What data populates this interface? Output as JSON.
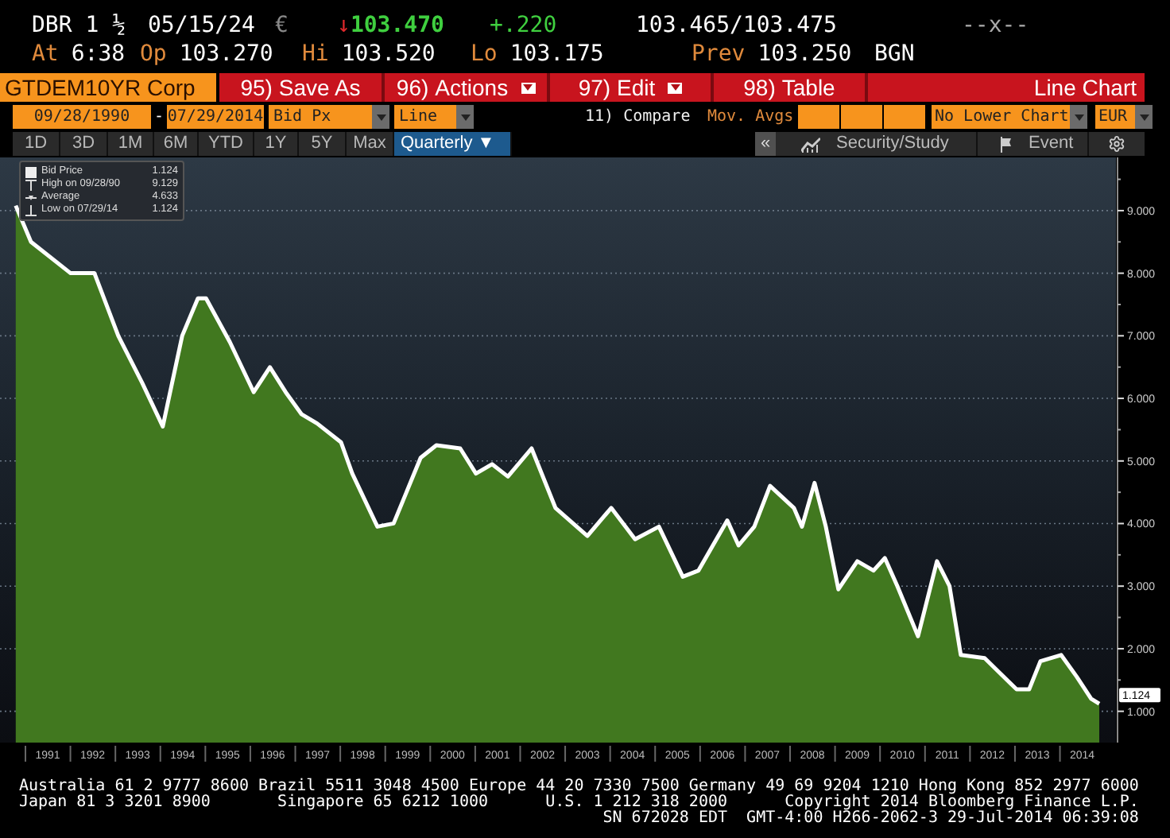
{
  "quote": {
    "security": "DBR 1 ½",
    "maturity": "05/15/24",
    "currency": "€",
    "arrow": "↓",
    "last": "103.470",
    "change": "+.220",
    "bid_ask": "103.465/103.475",
    "status": "--x--"
  },
  "stats": [
    {
      "label": "At",
      "value": "6:38"
    },
    {
      "label": "Op",
      "value": "103.270"
    },
    {
      "label": "Hi",
      "value": "103.520"
    },
    {
      "label": "Lo",
      "value": "103.175"
    },
    {
      "label": "Prev",
      "value": "103.250"
    }
  ],
  "source": "BGN",
  "ticker_field": "GTDEM10YR Corp",
  "menu_buttons": [
    {
      "number": "95)",
      "label": "Save As",
      "dropdown": false
    },
    {
      "number": "96)",
      "label": "Actions",
      "dropdown": true
    },
    {
      "number": "97)",
      "label": "Edit",
      "dropdown": true
    },
    {
      "number": "98)",
      "label": "Table",
      "dropdown": false
    }
  ],
  "view_title": "Line Chart",
  "settings": {
    "start_date": "09/28/1990",
    "separator": "-",
    "end_date": "07/29/2014",
    "field": "Bid Px",
    "chart_type": "Line",
    "compare": "11) Compare",
    "mov_avgs": "Mov. Avgs",
    "lower_chart": "No Lower Chart",
    "currency": "EUR"
  },
  "periods": [
    {
      "label": "1D",
      "selected": false
    },
    {
      "label": "3D",
      "selected": false
    },
    {
      "label": "1M",
      "selected": false
    },
    {
      "label": "6M",
      "selected": false
    },
    {
      "label": "YTD",
      "selected": false
    },
    {
      "label": "1Y",
      "selected": false
    },
    {
      "label": "5Y",
      "selected": false
    },
    {
      "label": "Max",
      "selected": false
    },
    {
      "label": "Quarterly ▼",
      "selected": true
    }
  ],
  "toolbar": {
    "collapse": "«",
    "security_study": "Security/Study",
    "event": "Event"
  },
  "legend": [
    {
      "kind": "price",
      "value": "1.124"
    },
    {
      "kind": "high",
      "label": "High on 09/28/90",
      "value": "9.129"
    },
    {
      "kind": "average",
      "label": "Average",
      "value": "4.633"
    },
    {
      "kind": "low",
      "label": "Low on 07/29/14",
      "value": "1.124"
    }
  ],
  "chart": {
    "last_label": "1.124",
    "chart_data": {
      "type": "area",
      "grid": true,
      "xlim": [
        1989.94,
        2014.75
      ],
      "ylim": [
        0.5,
        9.85
      ],
      "x": [
        1990.29,
        1990.63,
        1991.51,
        1992.04,
        1992.57,
        1993.1,
        1993.56,
        1993.99,
        1994.34,
        1994.52,
        1995.05,
        1995.58,
        1995.94,
        1996.29,
        1996.64,
        1996.99,
        1997.52,
        1997.77,
        1998.33,
        1998.69,
        1999.29,
        1999.64,
        2000.17,
        2000.52,
        2000.88,
        2001.23,
        2001.76,
        2002.29,
        2003.0,
        2003.53,
        2004.06,
        2004.59,
        2005.12,
        2005.47,
        2006.11,
        2006.36,
        2006.71,
        2007.06,
        2007.59,
        2007.77,
        2008.05,
        2008.3,
        2008.58,
        2009.0,
        2009.36,
        2009.61,
        2009.89,
        2010.35,
        2010.77,
        2011.05,
        2011.3,
        2011.83,
        2012.54,
        2012.82,
        2013.07,
        2013.53,
        2013.88,
        2014.2,
        2014.38
      ],
      "series": [
        {
          "name": "Bid Price",
          "color": "#ffffff",
          "values": [
            9.08,
            8.5,
            8.0,
            8.0,
            7.0,
            6.25,
            5.55,
            7.0,
            7.6,
            7.6,
            6.9,
            6.1,
            6.5,
            6.1,
            5.75,
            5.6,
            5.3,
            4.8,
            3.95,
            4.0,
            5.05,
            5.25,
            5.2,
            4.8,
            4.95,
            4.75,
            5.2,
            4.25,
            3.8,
            4.25,
            3.75,
            3.95,
            3.15,
            3.25,
            4.05,
            3.65,
            3.95,
            4.6,
            4.25,
            3.95,
            4.65,
            3.95,
            2.95,
            3.4,
            3.25,
            3.45,
            3.0,
            2.2,
            3.4,
            3.0,
            1.9,
            1.85,
            1.35,
            1.35,
            1.8,
            1.9,
            1.55,
            1.2,
            1.12
          ]
        }
      ],
      "xticks": [
        1991,
        1992,
        1993,
        1994,
        1995,
        1996,
        1997,
        1998,
        1999,
        2000,
        2001,
        2002,
        2003,
        2004,
        2005,
        2006,
        2007,
        2008,
        2009,
        2010,
        2011,
        2012,
        2013,
        2014
      ],
      "yticks": [
        {
          "value": 1,
          "label": "1.000"
        },
        {
          "value": 2,
          "label": "2.000"
        },
        {
          "value": 3,
          "label": "3.000"
        },
        {
          "value": 4,
          "label": "4.000"
        },
        {
          "value": 5,
          "label": "5.000"
        },
        {
          "value": 6,
          "label": "6.000"
        },
        {
          "value": 7,
          "label": "7.000"
        },
        {
          "value": 8,
          "label": "8.000"
        },
        {
          "value": 9,
          "label": "9.000"
        }
      ]
    }
  },
  "footer": [
    "Australia 61 2 9777 8600 Brazil 5511 3048 4500 Europe 44 20 7330 7500 Germany 49 69 9204 1210 Hong Kong 852 2977 6000",
    "Japan 81 3 3201 8900       Singapore 65 6212 1000      U.S. 1 212 318 2000      Copyright 2014 Bloomberg Finance L.P.",
    "SN 672028 EDT  GMT-4:00 H266-2062-3 29-Jul-2014 06:39:08"
  ]
}
